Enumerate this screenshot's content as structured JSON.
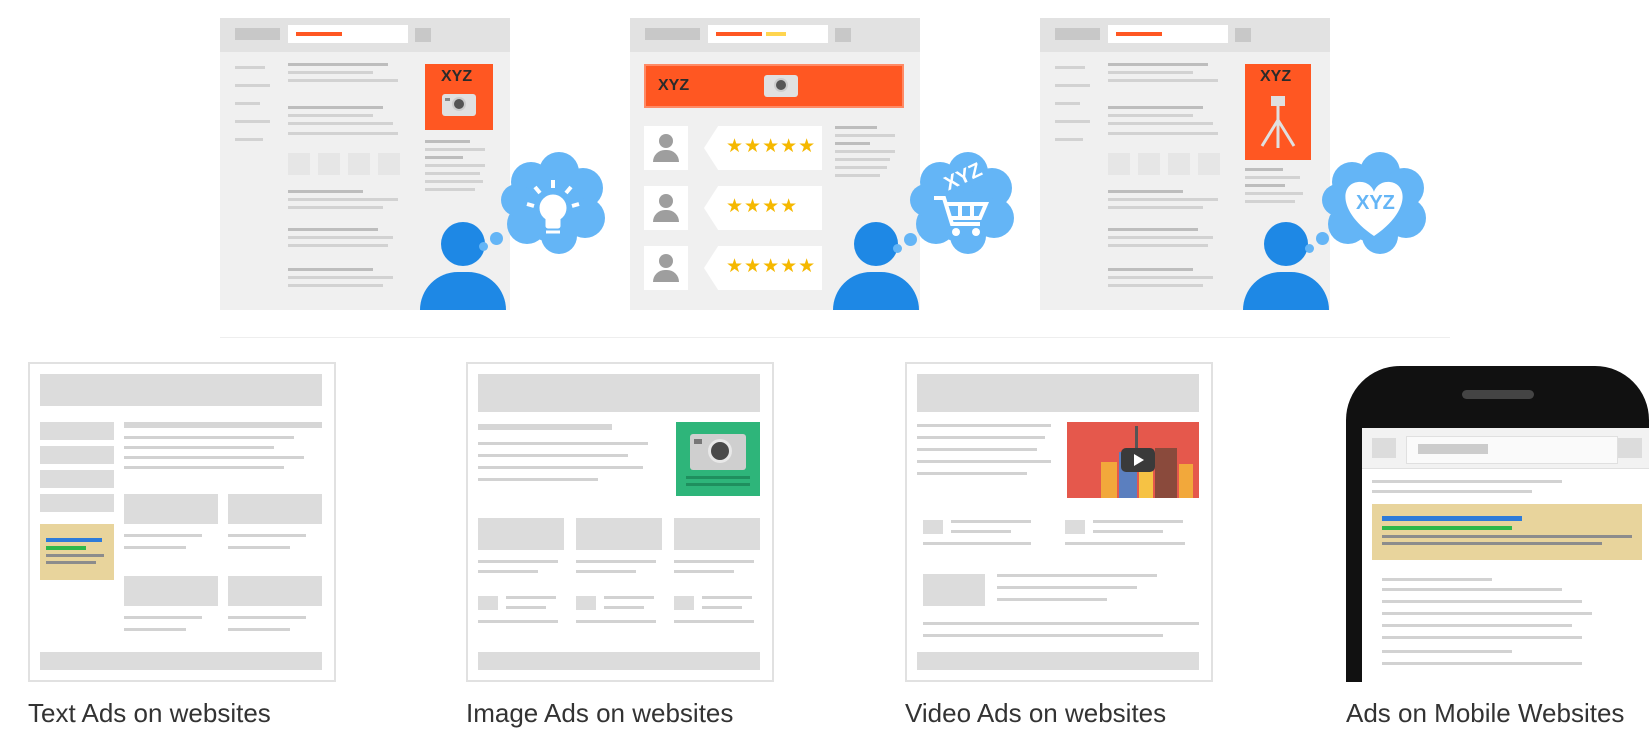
{
  "scenes": {
    "scene1": {
      "brand_text": "XYZ",
      "thought": "lightbulb-icon"
    },
    "scene2": {
      "brand_text": "XYZ",
      "thought_text": "XYZ",
      "thought": "shopping-cart-icon",
      "reviews": [
        {
          "stars": 5
        },
        {
          "stars": 4
        },
        {
          "stars": 5
        }
      ]
    },
    "scene3": {
      "brand_text": "XYZ",
      "thought_text": "XYZ",
      "thought": "heart-icon"
    }
  },
  "cards": [
    {
      "caption": "Text Ads on websites"
    },
    {
      "caption": "Image Ads on websites"
    },
    {
      "caption": "Video Ads on websites"
    },
    {
      "caption": "Ads on Mobile Websites"
    }
  ],
  "colors": {
    "accent_orange": "#ff5722",
    "user_blue": "#1e88e5",
    "thought_blue": "#64b5f6",
    "ad_highlight": "#e8d49c",
    "link_blue": "#2e7bd9",
    "link_green": "#2eb84a",
    "image_ad_green": "#2eb57a",
    "video_ad_red": "#e5584c",
    "star_yellow": "#f5b800"
  }
}
